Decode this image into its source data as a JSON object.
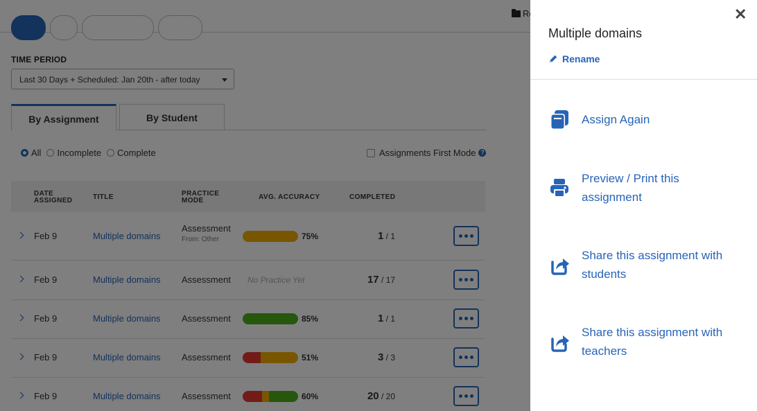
{
  "header": {
    "folder_label": "Re"
  },
  "time_period": {
    "label": "TIME PERIOD",
    "value": "Last 30 Days + Scheduled: Jan 20th - after today"
  },
  "tabs": [
    {
      "label": "By Assignment",
      "active": true
    },
    {
      "label": "By Student",
      "active": false
    }
  ],
  "filters": {
    "options": [
      "All",
      "Incomplete",
      "Complete"
    ],
    "selected": "All",
    "assignments_first_mode": "Assignments First Mode"
  },
  "table": {
    "headers": {
      "date": [
        "DATE",
        "ASSIGNED"
      ],
      "title": "TITLE",
      "mode": [
        "PRACTICE",
        "MODE"
      ],
      "accuracy": "AVG. ACCURACY",
      "completed": "COMPLETED"
    },
    "rows": [
      {
        "date": "Feb 9",
        "title": "Multiple domains",
        "mode": "Assessment",
        "mode_sub": "From: Other",
        "accuracy": "75%",
        "segments": [
          {
            "color": "#f0ad00",
            "frac": 1.0
          }
        ],
        "done": "1",
        "total": " / 1"
      },
      {
        "date": "Feb 9",
        "title": "Multiple domains",
        "mode": "Assessment",
        "mode_sub": "",
        "accuracy": "",
        "no_practice": "No Practice Yet",
        "segments": [],
        "done": "17",
        "total": " / 17"
      },
      {
        "date": "Feb 9",
        "title": "Multiple domains",
        "mode": "Assessment",
        "mode_sub": "",
        "accuracy": "85%",
        "segments": [
          {
            "color": "#4caf1a",
            "frac": 1.0
          }
        ],
        "done": "1",
        "total": " / 1"
      },
      {
        "date": "Feb 9",
        "title": "Multiple domains",
        "mode": "Assessment",
        "mode_sub": "",
        "accuracy": "51%",
        "segments": [
          {
            "color": "#e53935",
            "frac": 0.33
          },
          {
            "color": "#f0ad00",
            "frac": 0.67
          }
        ],
        "done": "3",
        "total": " / 3"
      },
      {
        "date": "Feb 9",
        "title": "Multiple domains",
        "mode": "Assessment",
        "mode_sub": "",
        "accuracy": "60%",
        "segments": [
          {
            "color": "#e53935",
            "frac": 0.35
          },
          {
            "color": "#f0ad00",
            "frac": 0.12
          },
          {
            "color": "#4caf1a",
            "frac": 0.53
          }
        ],
        "done": "20",
        "total": " / 20"
      }
    ]
  },
  "panel": {
    "title": "Multiple domains",
    "close_glyph": "✕",
    "rename_label": "Rename",
    "actions": [
      {
        "label_lines": [
          "Assign Again"
        ],
        "icon": "copy-icon"
      },
      {
        "label_lines": [
          "Preview / Print this",
          "assignment"
        ],
        "icon": "printer-icon"
      },
      {
        "label_lines": [
          "Share this assignment with",
          "students"
        ],
        "icon": "share-icon"
      },
      {
        "label_lines": [
          "Share this assignment with",
          "teachers"
        ],
        "icon": "share-icon"
      }
    ]
  },
  "colors": {
    "accent": "#2764b8",
    "overlay": "rgba(0,0,0,0.5)"
  }
}
